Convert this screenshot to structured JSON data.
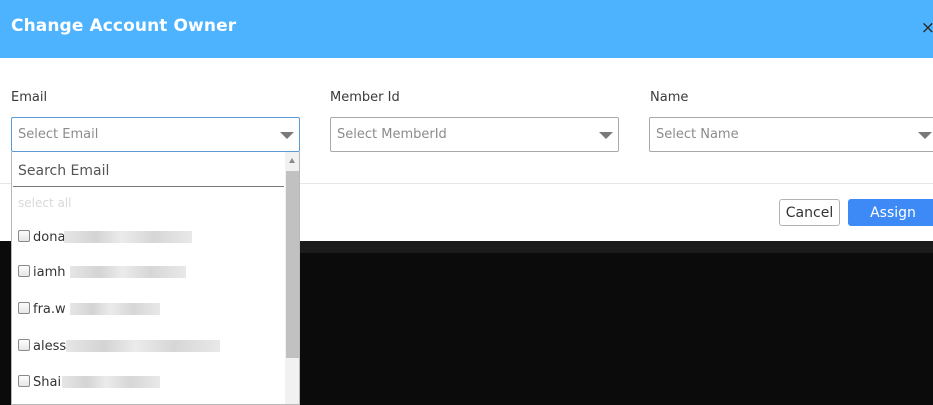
{
  "modal": {
    "title": "Change Account Owner",
    "close": "×"
  },
  "fields": {
    "email": {
      "label": "Email",
      "placeholder": "Select Email"
    },
    "member_id": {
      "label": "Member Id",
      "placeholder": "Select MemberId"
    },
    "name": {
      "label": "Name",
      "placeholder": "Select Name"
    }
  },
  "dropdown": {
    "search_placeholder": "Search Email",
    "select_all": "select all",
    "options": [
      {
        "text": "dona"
      },
      {
        "text": "iamh"
      },
      {
        "text": "fra.w"
      },
      {
        "text": "aless"
      },
      {
        "text": "Shai"
      }
    ]
  },
  "buttons": {
    "cancel": "Cancel",
    "assign": "Assign"
  },
  "colors": {
    "header": "#4db3ff",
    "assign_button": "#3d8af7",
    "backdrop": "#0b0b0b"
  }
}
